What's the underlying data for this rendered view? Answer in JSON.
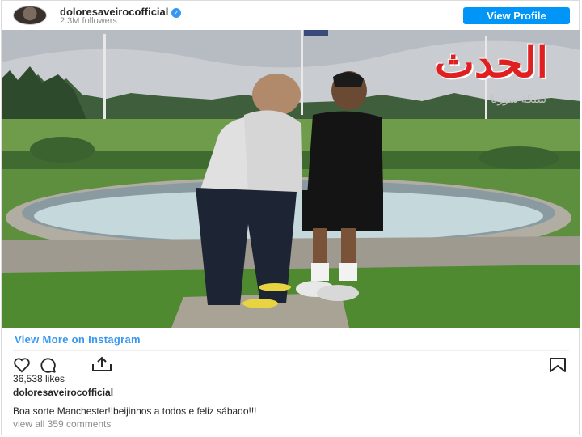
{
  "header": {
    "username": "doloresaveirocofficial",
    "followers": "2.3M followers",
    "view_profile_label": "View Profile"
  },
  "watermark": {
    "main": "الحدث",
    "sub": "شبكة سوريا"
  },
  "footer": {
    "view_more_label": "View More on Instagram",
    "likes": "36,538 likes",
    "caption_username": "doloresaveirocofficial",
    "caption_text": "Boa sorte Manchester!!beijinhos a todos e feliz sábado!!!",
    "comments_link": "view all 359 comments"
  },
  "icons": {
    "like": "heart-icon",
    "comment": "comment-icon",
    "share": "share-icon",
    "save": "bookmark-icon",
    "verified": "verified-badge-icon"
  },
  "colors": {
    "accent": "#0095f6",
    "link": "#3897f0",
    "watermark": "#e02020"
  }
}
